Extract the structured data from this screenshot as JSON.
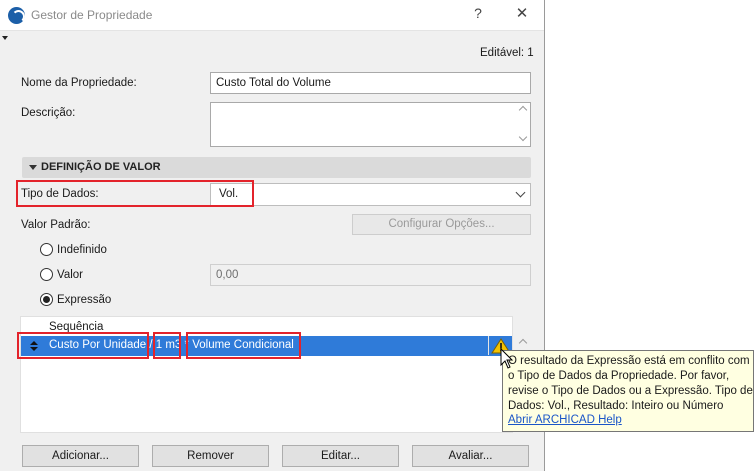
{
  "window": {
    "title": "Gestor de Propriedade",
    "help_glyph": "?",
    "close_glyph": "✕",
    "editable_label": "Editável: 1"
  },
  "form": {
    "name_label": "Nome da Propriedade:",
    "name_value": "Custo Total do Volume",
    "description_label": "Descrição:",
    "description_value": ""
  },
  "value_section": {
    "title": "DEFINIÇÃO DE VALOR",
    "data_type_label": "Tipo de Dados:",
    "data_type_value": "Vol.",
    "default_value_label": "Valor Padrão:",
    "configure_options_button": "Configurar Opções...",
    "radios": {
      "undefined": "Indefinido",
      "value": "Valor",
      "expression": "Expressão",
      "selected": "expression"
    },
    "value_field": "0,00"
  },
  "expression_list": {
    "header": "Sequência",
    "row": {
      "part1": "Custo Por Unidade",
      "sep1": " / ",
      "part2": "1 m3",
      "sep2": " * ",
      "part3": "Volume Condicional"
    }
  },
  "buttons": {
    "add": "Adicionar...",
    "remove": "Remover",
    "edit": "Editar...",
    "evaluate": "Avaliar..."
  },
  "tooltip": {
    "message": "O resultado da Expressão está em conflito com o Tipo de Dados da Propriedade. Por favor, revise o Tipo de Dados ou a Expressão. Tipo de Dados: Vol., Resultado: Inteiro ou Número",
    "link": "Abrir ARCHICAD Help"
  },
  "colors": {
    "selection": "#2f7bd9",
    "highlight_box": "#e3232b",
    "tooltip_bg": "#ffffe1",
    "link": "#1a55c8",
    "warning": "#f2c200"
  },
  "icons": {
    "app": "archicad-logo-icon",
    "warning": "warning-triangle-icon",
    "cursor": "mouse-pointer-icon"
  }
}
